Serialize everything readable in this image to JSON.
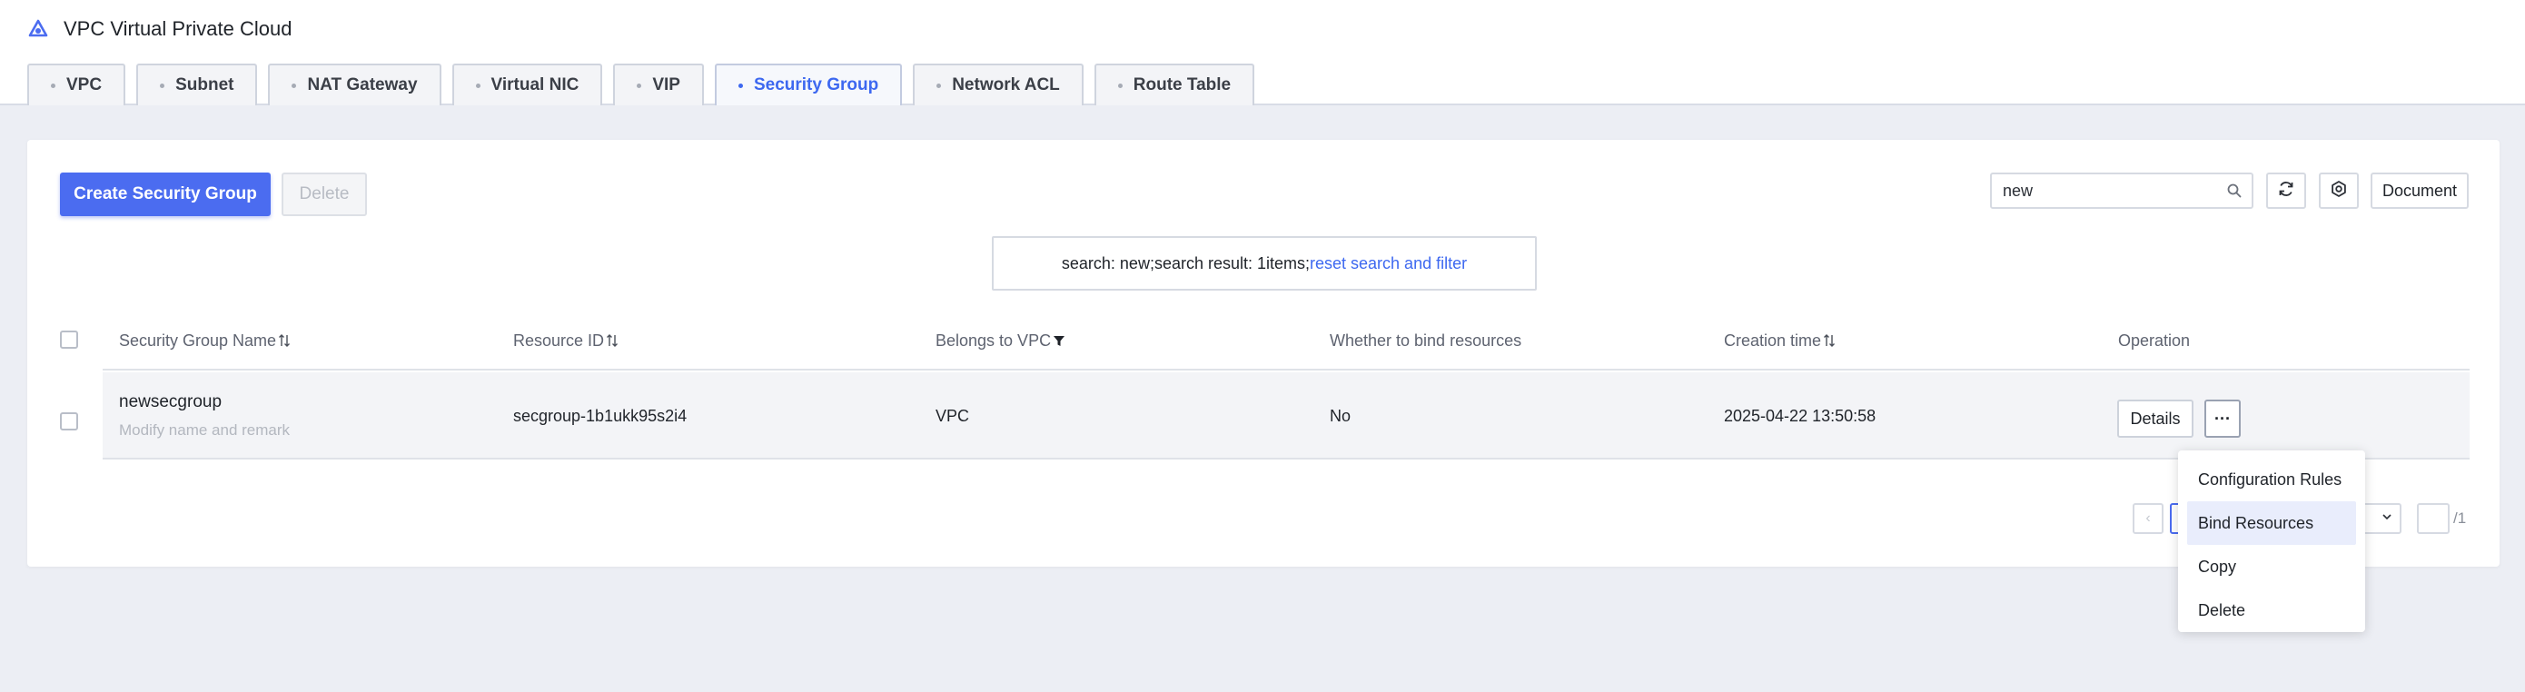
{
  "app": {
    "title": "VPC Virtual Private Cloud",
    "logo_icon": "cloud-logo-icon",
    "accent_color": "#4b6cf0"
  },
  "tabs": [
    {
      "label": "VPC",
      "active": false
    },
    {
      "label": "Subnet",
      "active": false
    },
    {
      "label": "NAT Gateway",
      "active": false
    },
    {
      "label": "Virtual NIC",
      "active": false
    },
    {
      "label": "VIP",
      "active": false
    },
    {
      "label": "Security Group",
      "active": true
    },
    {
      "label": "Network ACL",
      "active": false
    },
    {
      "label": "Route Table",
      "active": false
    }
  ],
  "toolbar": {
    "create_label": "Create Security Group",
    "delete_label": "Delete",
    "search_value": "new",
    "search_icon": "search-icon",
    "refresh_icon": "refresh-icon",
    "settings_icon": "gear-icon",
    "document_label": "Document"
  },
  "search_result": {
    "text": "search: new;search result: 1items;",
    "reset_label": "reset search and filter"
  },
  "table": {
    "headers": {
      "name": "Security Group Name",
      "resource_id": "Resource ID",
      "vpc": "Belongs to VPC",
      "bind": "Whether to bind resources",
      "created": "Creation time",
      "operation": "Operation"
    },
    "rows": [
      {
        "name": "newsecgroup",
        "name_hint": "Modify name and remark",
        "resource_id": "secgroup-1b1ukk95s2i4",
        "vpc": "VPC",
        "bind": "No",
        "created": "2025-04-22 13:50:58",
        "details_label": "Details",
        "more_label": "···"
      }
    ]
  },
  "pagination": {
    "prev_glyph": "‹",
    "total": "/1"
  },
  "dropdown": {
    "items": [
      {
        "label": "Configuration Rules"
      },
      {
        "label": "Bind Resources",
        "hover": true
      },
      {
        "label": "Copy"
      },
      {
        "label": "Delete"
      }
    ]
  }
}
